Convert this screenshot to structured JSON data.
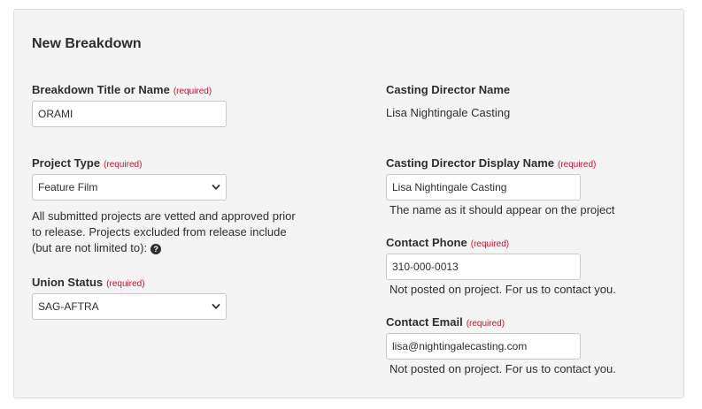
{
  "panel": {
    "title": "New Breakdown"
  },
  "required_text": "(required)",
  "left": {
    "breakdown_title": {
      "label": "Breakdown Title or Name",
      "value": "ORAMI"
    },
    "project_type": {
      "label": "Project Type",
      "selected": "Feature Film",
      "note": "All submitted projects are vetted and approved prior to release. Projects excluded from release include (but are not limited to):",
      "help_icon": "question-circle-icon"
    },
    "union_status": {
      "label": "Union Status",
      "selected": "SAG-AFTRA"
    }
  },
  "right": {
    "casting_director": {
      "label": "Casting Director Name",
      "value": "Lisa Nightingale Casting"
    },
    "display_name": {
      "label": "Casting Director Display Name",
      "value": "Lisa Nightingale Casting",
      "help": "The name as it should appear on the project"
    },
    "contact_phone": {
      "label": "Contact Phone",
      "value": "310-000-0013",
      "help": "Not posted on project. For us to contact you."
    },
    "contact_email": {
      "label": "Contact Email",
      "value": "lisa@nightingalecasting.com",
      "help": "Not posted on project. For us to contact you."
    }
  },
  "colors": {
    "panel_bg": "#f4f4f4",
    "required_red": "#c8102e",
    "text": "#2e2e2e"
  }
}
